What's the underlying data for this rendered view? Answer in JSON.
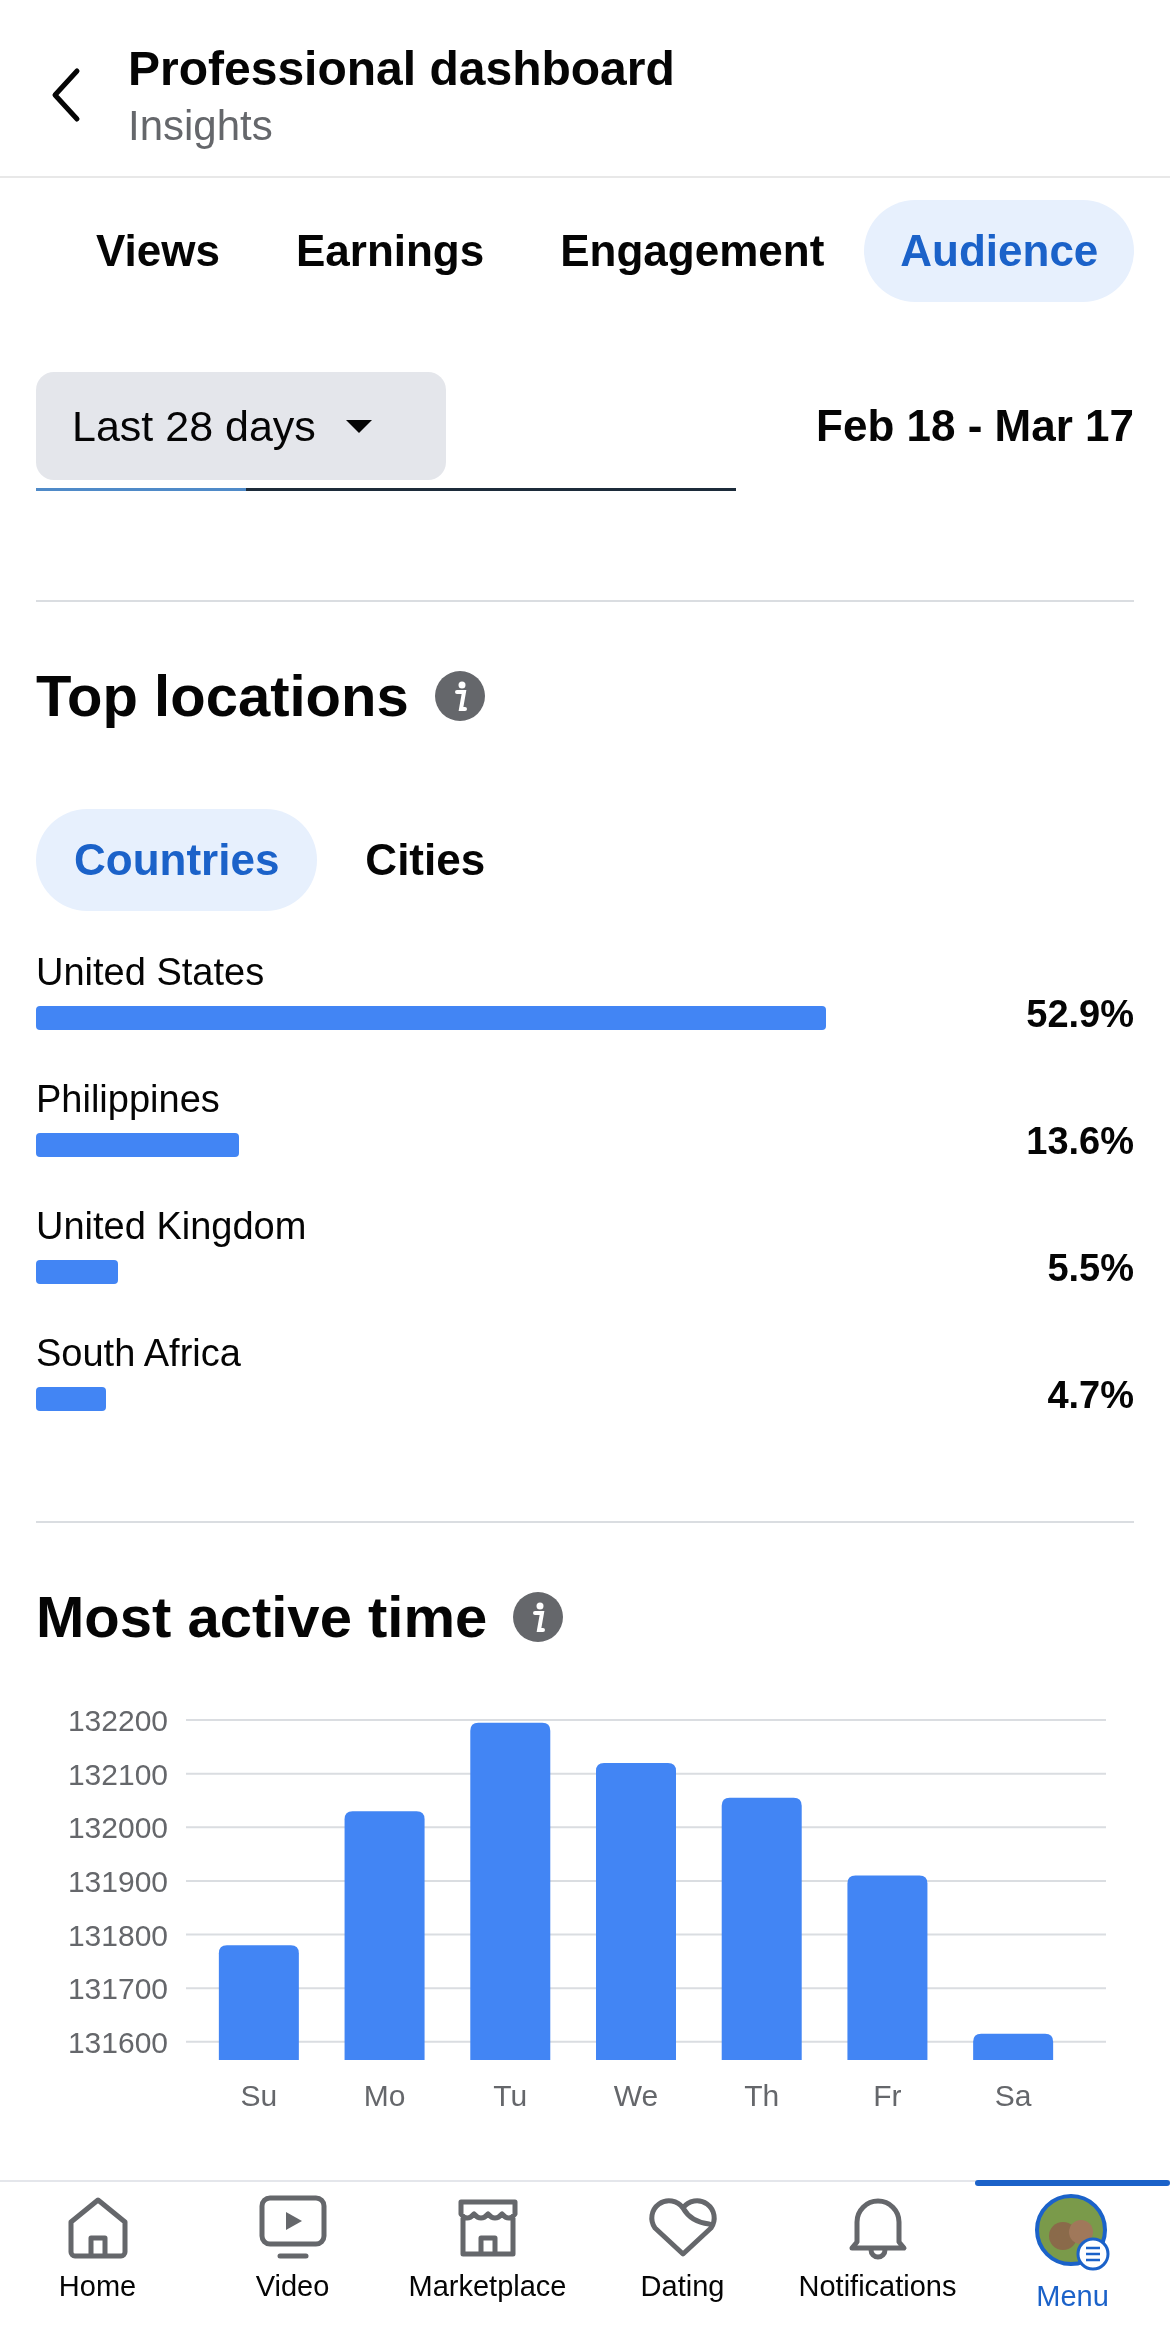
{
  "header": {
    "title": "Professional dashboard",
    "subtitle": "Insights"
  },
  "tabs": [
    {
      "label": "Views",
      "selected": false
    },
    {
      "label": "Earnings",
      "selected": false
    },
    {
      "label": "Engagement",
      "selected": false
    },
    {
      "label": "Audience",
      "selected": true
    }
  ],
  "filter": {
    "range": "Last 28 days",
    "dates": "Feb 18 - Mar 17"
  },
  "top_locations": {
    "title": "Top locations",
    "chips": [
      {
        "label": "Countries",
        "selected": true
      },
      {
        "label": "Cities",
        "selected": false
      }
    ],
    "rows": [
      {
        "name": "United States",
        "reading": "52.9%"
      },
      {
        "name": "Philippines",
        "reading": "13.6%"
      },
      {
        "name": "United Kingdom",
        "reading": "5.5%"
      },
      {
        "name": "South Africa",
        "reading": "4.7%"
      }
    ]
  },
  "most_active_time": {
    "title": "Most active time",
    "chart_data": {
      "type": "bar",
      "categories": [
        "Su",
        "Mo",
        "Tu",
        "We",
        "Th",
        "Fr",
        "Sa"
      ],
      "series": [
        {
          "color": "#4285f4",
          "values": [
            131780,
            132030,
            132195,
            132120,
            132055,
            131910,
            131615
          ]
        }
      ],
      "grid": true,
      "ylim": [
        131566,
        132200
      ],
      "yticks": [
        131600,
        131700,
        131800,
        131900,
        132000,
        132100,
        132200
      ]
    }
  },
  "nav": [
    {
      "kind": "home",
      "label": "Home",
      "selected": false
    },
    {
      "kind": "video",
      "label": "Video",
      "selected": false
    },
    {
      "kind": "market",
      "label": "Marketplace",
      "selected": false
    },
    {
      "kind": "dating",
      "label": "Dating",
      "selected": false
    },
    {
      "kind": "bell",
      "label": "Notifications",
      "selected": false
    },
    {
      "kind": "avatar",
      "label": "Menu",
      "selected": true
    }
  ]
}
